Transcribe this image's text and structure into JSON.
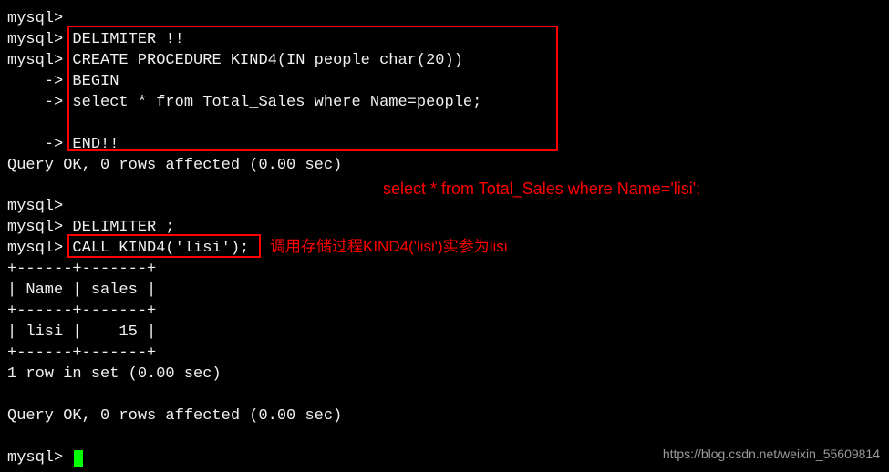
{
  "terminal": {
    "prompt": "mysql>",
    "cont_prompt": "    ->",
    "lines": {
      "l1": " ",
      "l2": " DELIMITER !!",
      "l3": " CREATE PROCEDURE KIND4(IN people char(20))",
      "l4": " BEGIN",
      "l5": " select * from Total_Sales where Name=people;",
      "l6": "",
      "l7": " END!!",
      "l8": "Query OK, 0 rows affected (0.00 sec)",
      "l9": "",
      "l10": " ",
      "l11": " DELIMITER ;",
      "l12": " CALL KIND4('lisi');",
      "l13": "+------+-------+",
      "l14": "| Name | sales |",
      "l15": "+------+-------+",
      "l16": "| lisi |    15 |",
      "l17": "+------+-------+",
      "l18": "1 row in set (0.00 sec)",
      "l19": "",
      "l20": "Query OK, 0 rows affected (0.00 sec)",
      "l21": "",
      "l22": " "
    }
  },
  "annotations": {
    "anno1": "select * from Total_Sales where Name='lisi';",
    "anno2": "调用存储过程KIND4('lisi')实参为lisi"
  },
  "watermark": "https://blog.csdn.net/weixin_55609814",
  "chart_data": {
    "type": "table",
    "columns": [
      "Name",
      "sales"
    ],
    "rows": [
      [
        "lisi",
        15
      ]
    ],
    "title": "Result of CALL KIND4('lisi')"
  }
}
